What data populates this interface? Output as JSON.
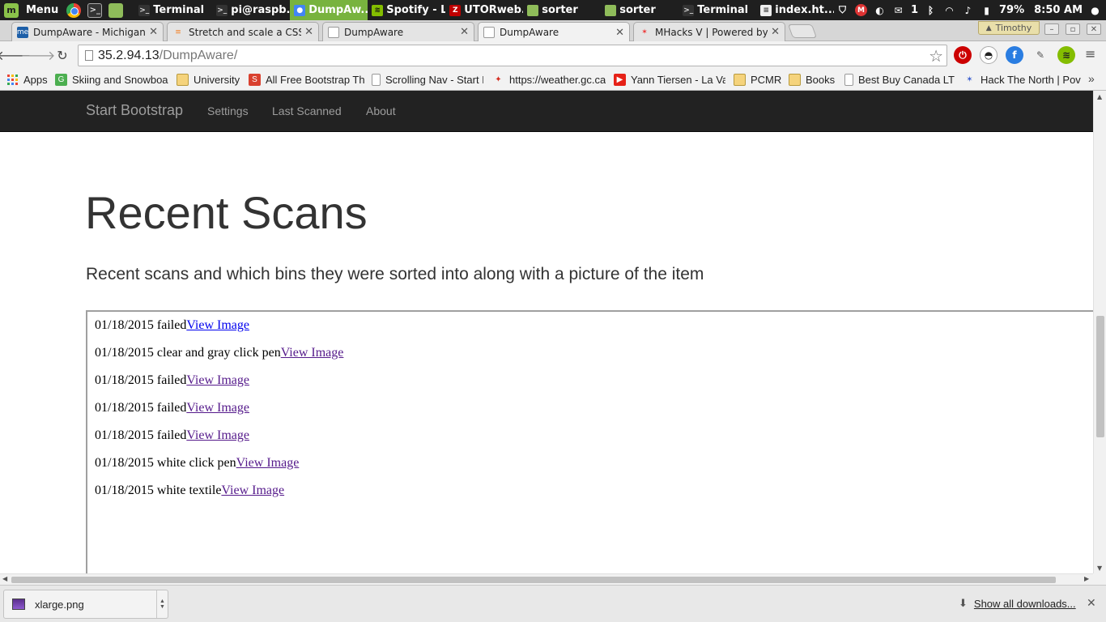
{
  "taskbar": {
    "menu_label": "Menu",
    "windows": [
      {
        "label": "Terminal",
        "icon": "terminal-icon",
        "active": false
      },
      {
        "label": "pi@raspb...",
        "icon": "terminal-icon",
        "active": false
      },
      {
        "label": "DumpAw...",
        "icon": "chrome-icon",
        "active": true
      },
      {
        "label": "Spotify - L...",
        "icon": "spotify-icon",
        "active": false
      },
      {
        "label": "UTORweb...",
        "icon": "filezilla-icon",
        "active": false
      },
      {
        "label": "sorter",
        "icon": "folder-icon",
        "active": false
      },
      {
        "label": "sorter",
        "icon": "folder-icon",
        "active": false
      },
      {
        "label": "Terminal",
        "icon": "terminal-icon",
        "active": false
      },
      {
        "label": "index.ht...",
        "icon": "text-editor-icon",
        "active": false
      }
    ],
    "tray": {
      "notification_count": "1",
      "battery": "79%",
      "clock": "8:50 AM"
    }
  },
  "browser": {
    "profile_name": "Timothy",
    "tabs": [
      {
        "label": "DumpAware - Michigan,",
        "favicon": "me-icon",
        "active": false
      },
      {
        "label": "Stretch and scale a CSS i",
        "favicon": "stackoverflow-icon",
        "active": false
      },
      {
        "label": "DumpAware",
        "favicon": "page-icon",
        "active": false
      },
      {
        "label": "DumpAware",
        "favicon": "page-icon",
        "active": true
      },
      {
        "label": "MHacks V | Powered by",
        "favicon": "mhacks-icon",
        "active": false
      }
    ],
    "url_host": "35.2.94.13",
    "url_path": "/DumpAware/",
    "bookmarks": [
      {
        "label": "Apps",
        "icon": "apps-icon"
      },
      {
        "label": "Skiing and Snowboar",
        "icon": "g-icon"
      },
      {
        "label": "University",
        "icon": "folder-icon"
      },
      {
        "label": "All Free Bootstrap Th",
        "icon": "s-icon"
      },
      {
        "label": "Scrolling Nav - Start E",
        "icon": "page-icon"
      },
      {
        "label": "https://weather.gc.ca",
        "icon": "maple-leaf-icon"
      },
      {
        "label": "Yann Tiersen - La Val",
        "icon": "youtube-icon"
      },
      {
        "label": "PCMR",
        "icon": "folder-icon"
      },
      {
        "label": "Books",
        "icon": "folder-icon"
      },
      {
        "label": "Best Buy Canada LTD",
        "icon": "page-icon"
      },
      {
        "label": "Hack The North | Pov",
        "icon": "hackthenorth-icon"
      }
    ],
    "bookmarks_overflow": "»"
  },
  "page": {
    "brand": "Start Bootstrap",
    "nav": [
      "Settings",
      "Last Scanned",
      "About"
    ],
    "title": "Recent Scans",
    "lead": "Recent scans and which bins they were sorted into along with a picture of the item",
    "scans": [
      {
        "date": "01/18/2015",
        "label": "failed",
        "link": "View Image",
        "visited": false
      },
      {
        "date": "01/18/2015",
        "label": "clear and gray click pen",
        "link": "View Image",
        "visited": true
      },
      {
        "date": "01/18/2015",
        "label": "failed",
        "link": "View Image",
        "visited": true
      },
      {
        "date": "01/18/2015",
        "label": "failed",
        "link": "View Image",
        "visited": true
      },
      {
        "date": "01/18/2015",
        "label": "failed",
        "link": "View Image",
        "visited": true
      },
      {
        "date": "01/18/2015",
        "label": "white click pen",
        "link": "View Image",
        "visited": true
      },
      {
        "date": "01/18/2015",
        "label": "white textile",
        "link": "View Image",
        "visited": true
      }
    ]
  },
  "downloads": {
    "file_name": "xlarge.png",
    "show_all": "Show all downloads..."
  },
  "colors": {
    "taskbar_bg": "#1f1f1f",
    "taskbar_active": "#78b33e",
    "navbar_bg": "#222222",
    "navbar_text": "#9d9d9d",
    "link": "#0000ee",
    "visited_link": "#551a8b"
  }
}
